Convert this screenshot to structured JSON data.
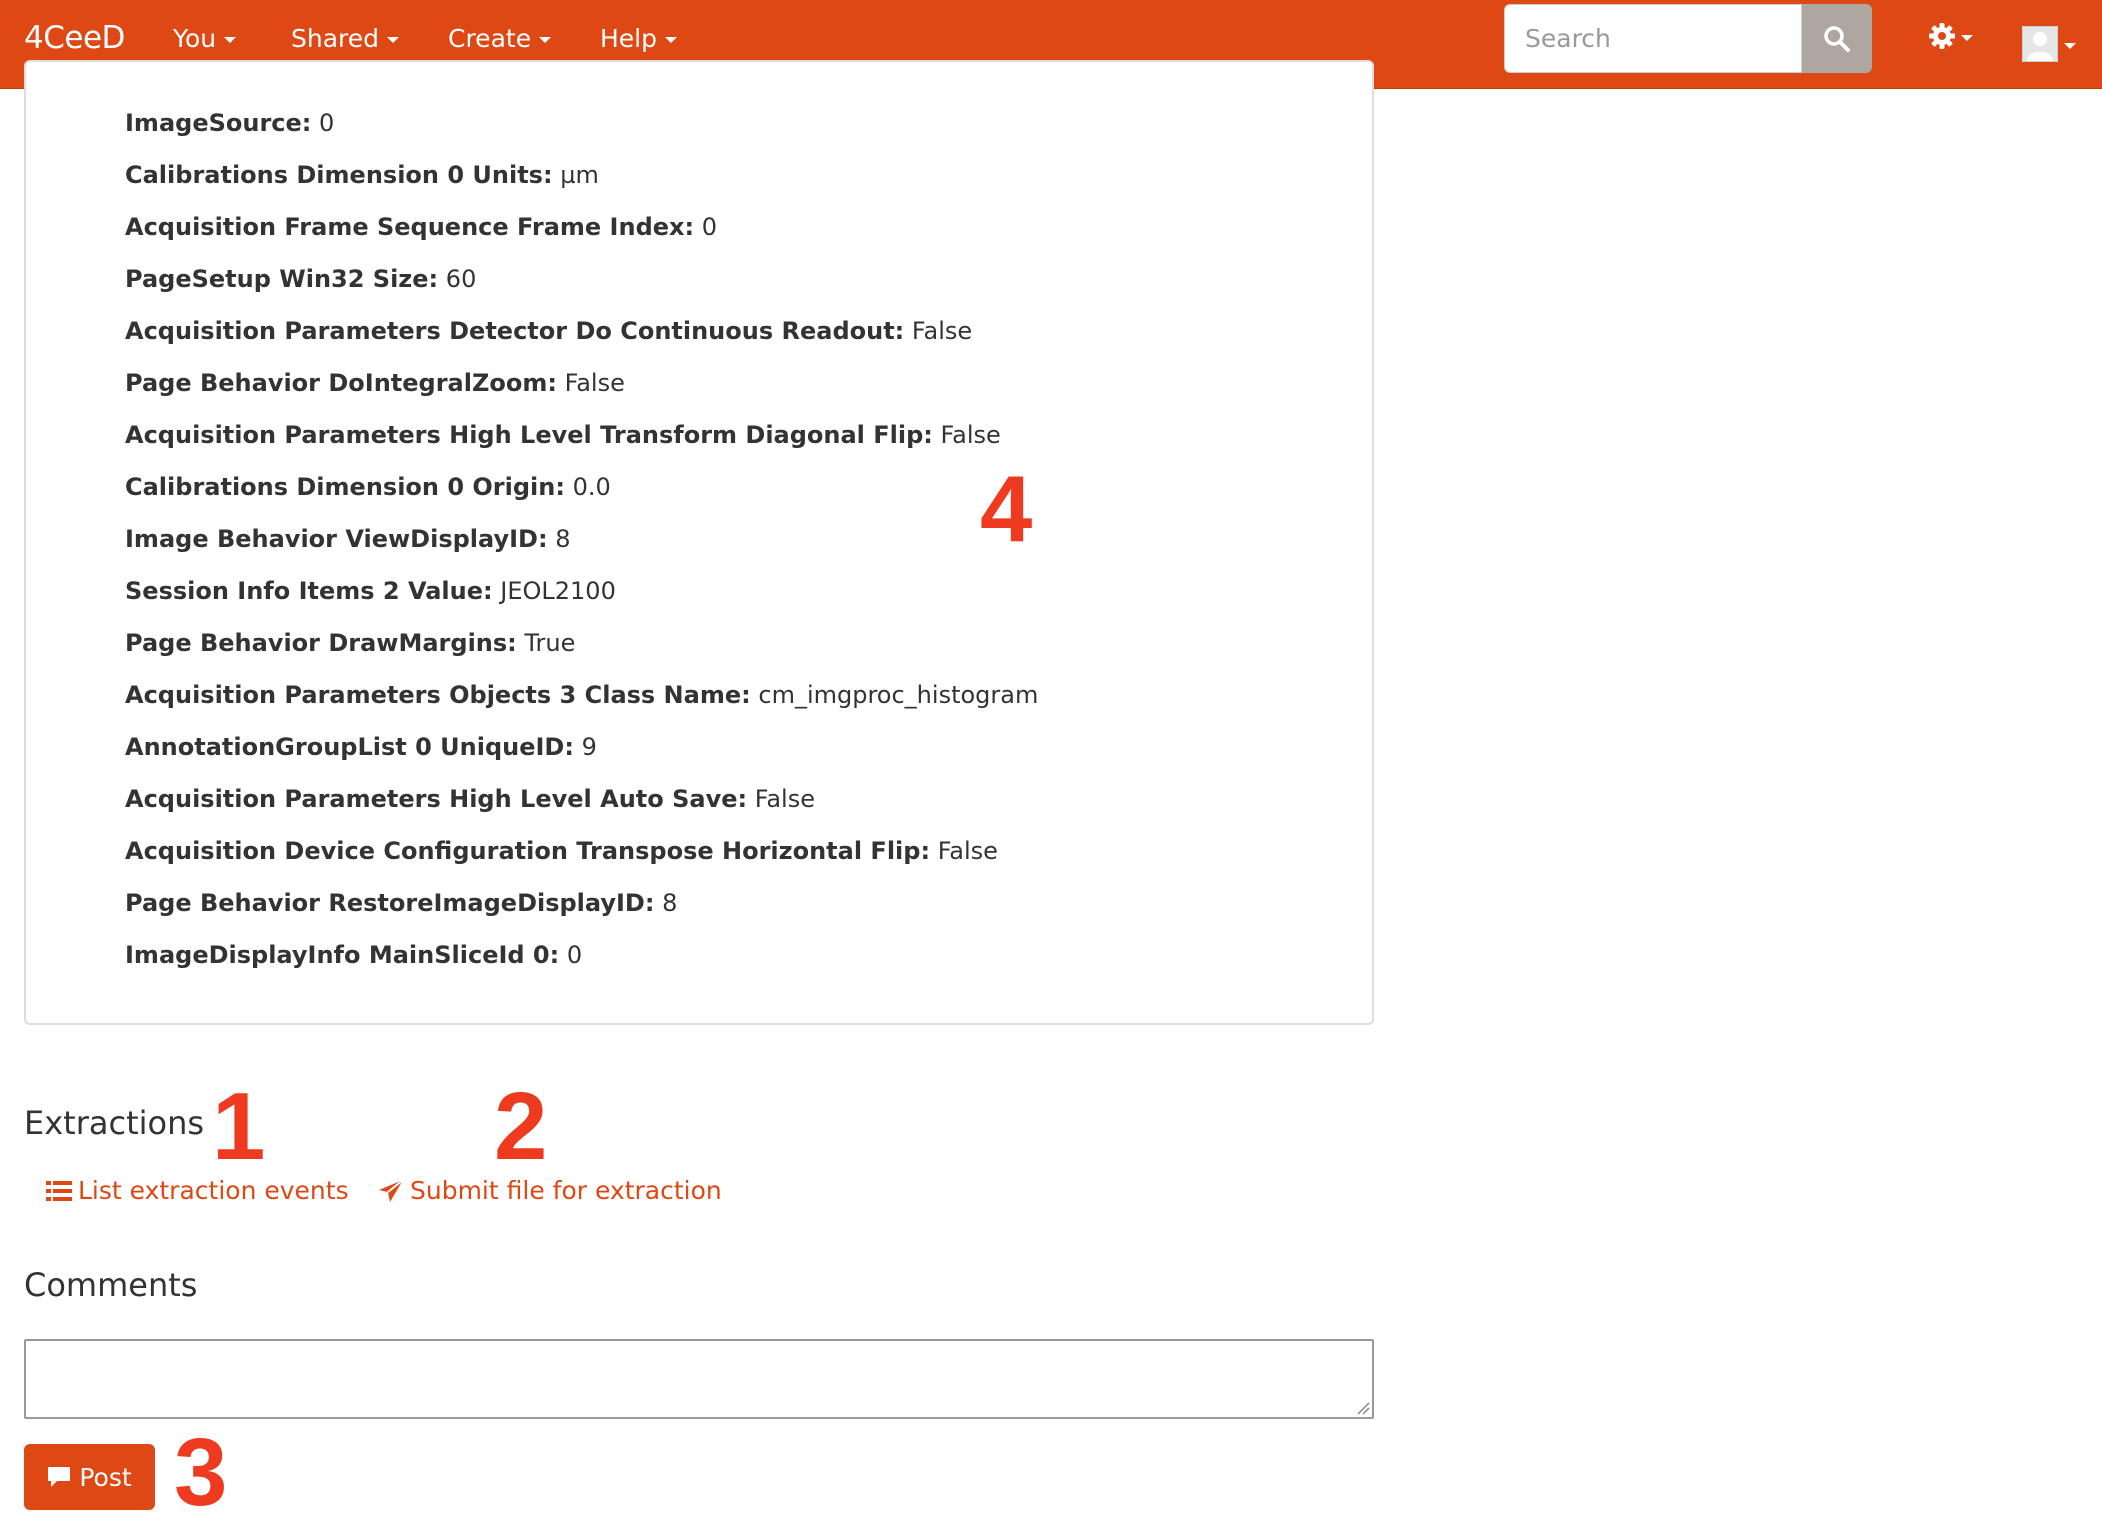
{
  "navbar": {
    "brand": "4CeeD",
    "menus": [
      {
        "label": "You"
      },
      {
        "label": "Shared"
      },
      {
        "label": "Create"
      },
      {
        "label": "Help"
      }
    ],
    "search": {
      "placeholder": "Search",
      "value": ""
    },
    "icons": {
      "search": "search-icon",
      "settings": "gear-icon",
      "user": "avatar-icon"
    }
  },
  "metadata": [
    {
      "key": "ImageSource:",
      "value": "0"
    },
    {
      "key": "Calibrations Dimension 0 Units:",
      "value": "µm"
    },
    {
      "key": "Acquisition Frame Sequence Frame Index:",
      "value": "0"
    },
    {
      "key": "PageSetup Win32 Size:",
      "value": "60"
    },
    {
      "key": "Acquisition Parameters Detector Do Continuous Readout:",
      "value": "False"
    },
    {
      "key": "Page Behavior DoIntegralZoom:",
      "value": "False"
    },
    {
      "key": "Acquisition Parameters High Level Transform Diagonal Flip:",
      "value": "False"
    },
    {
      "key": "Calibrations Dimension 0 Origin:",
      "value": "0.0"
    },
    {
      "key": "Image Behavior ViewDisplayID:",
      "value": "8"
    },
    {
      "key": "Session Info Items 2 Value:",
      "value": "JEOL2100"
    },
    {
      "key": "Page Behavior DrawMargins:",
      "value": "True"
    },
    {
      "key": "Acquisition Parameters Objects 3 Class Name:",
      "value": "cm_imgproc_histogram"
    },
    {
      "key": "AnnotationGroupList 0 UniqueID:",
      "value": "9"
    },
    {
      "key": "Acquisition Parameters High Level Auto Save:",
      "value": "False"
    },
    {
      "key": "Acquisition Device Configuration Transpose Horizontal Flip:",
      "value": "False"
    },
    {
      "key": "Page Behavior RestoreImageDisplayID:",
      "value": "8"
    },
    {
      "key": "ImageDisplayInfo MainSliceId 0:",
      "value": "0"
    }
  ],
  "extractions": {
    "heading": "Extractions",
    "list_link": "List extraction events",
    "submit_link": "Submit file for extraction"
  },
  "comments": {
    "heading": "Comments",
    "textarea_value": "",
    "post_label": "Post"
  },
  "annotations": {
    "one": "1",
    "two": "2",
    "three": "3",
    "four": "4",
    "color": "#ee3a1e"
  },
  "colors": {
    "brand": "#dd4814",
    "search_button": "#aea79f",
    "text": "#333333"
  }
}
